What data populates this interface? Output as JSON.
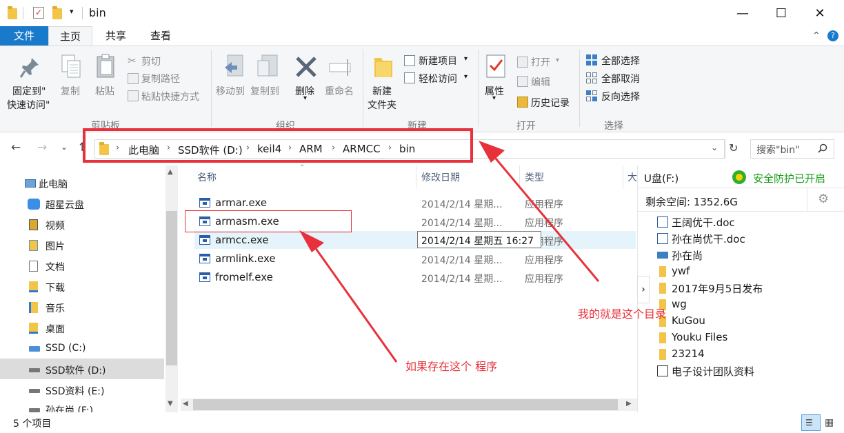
{
  "window": {
    "title": "bin",
    "minimize": "—",
    "maximize": "☐",
    "close": "✕"
  },
  "tabs": [
    "文件",
    "主页",
    "共享",
    "查看"
  ],
  "ribbon": {
    "pin_label_1": "固定到\"",
    "pin_label_2": "快速访问\"",
    "copy": "复制",
    "paste": "粘贴",
    "cut": "剪切",
    "copy_path": "复制路径",
    "paste_shortcut": "粘贴快捷方式",
    "clipboard_group": "剪贴板",
    "move_to": "移动到",
    "copy_to": "复制到",
    "delete": "删除",
    "rename": "重命名",
    "organize_group": "组织",
    "new_folder_1": "新建",
    "new_folder_2": "文件夹",
    "new_item": "新建项目",
    "easy_access": "轻松访问",
    "new_group": "新建",
    "properties": "属性",
    "open": "打开",
    "edit": "编辑",
    "history": "历史记录",
    "open_group": "打开",
    "select_all": "全部选择",
    "select_none": "全部取消",
    "invert_selection": "反向选择",
    "select_group": "选择"
  },
  "address": {
    "crumbs": [
      "此电脑",
      "SSD软件 (D:)",
      "keil4",
      "ARM",
      "ARMCC",
      "bin"
    ],
    "search_placeholder": "搜索\"bin\""
  },
  "nav": [
    {
      "label": "此电脑",
      "icon": "computer-icon"
    },
    {
      "label": "超星云盘",
      "icon": "cloud-drive-icon"
    },
    {
      "label": "视频",
      "icon": "video-icon"
    },
    {
      "label": "图片",
      "icon": "picture-icon"
    },
    {
      "label": "文档",
      "icon": "document-icon"
    },
    {
      "label": "下载",
      "icon": "download-icon"
    },
    {
      "label": "音乐",
      "icon": "music-icon"
    },
    {
      "label": "桌面",
      "icon": "desktop-icon"
    },
    {
      "label": "SSD (C:)",
      "icon": "drive-icon"
    },
    {
      "label": "SSD软件 (D:)",
      "icon": "drive-icon"
    },
    {
      "label": "SSD资料 (E:)",
      "icon": "drive-icon"
    },
    {
      "label": "孙在尚 (F:)",
      "icon": "drive-icon"
    }
  ],
  "columns": {
    "name": "名称",
    "date": "修改日期",
    "type": "类型",
    "size": "大"
  },
  "files": [
    {
      "name": "armar.exe",
      "date": "2014/2/14 星期...",
      "type": "应用程序"
    },
    {
      "name": "armasm.exe",
      "date": "2014/2/14 星期...",
      "type": "应用程序"
    },
    {
      "name": "armcc.exe",
      "date": "2014/2/14 星期...",
      "type": "应用程序"
    },
    {
      "name": "armlink.exe",
      "date": "2014/2/14 星期...",
      "type": "应用程序"
    },
    {
      "name": "fromelf.exe",
      "date": "2014/2/14 星期...",
      "type": "应用程序"
    }
  ],
  "tooltip": "2014/2/14 星期五 16:27",
  "usb_panel": {
    "title": "U盘(F:)",
    "protection": "安全防护已开启",
    "free_space": "剩余空间: 1352.6G",
    "items": [
      {
        "label": "王阔优干.doc",
        "icon": "word-doc-icon"
      },
      {
        "label": "孙在尚优干.doc",
        "icon": "word-doc-icon"
      },
      {
        "label": "孙在尚",
        "icon": "user-folder-icon"
      },
      {
        "label": "ywf",
        "icon": "folder-icon"
      },
      {
        "label": "2017年9月5日发布",
        "icon": "folder-icon"
      },
      {
        "label": "wg",
        "icon": "folder-icon"
      },
      {
        "label": "KuGou",
        "icon": "folder-icon"
      },
      {
        "label": "Youku Files",
        "icon": "folder-icon"
      },
      {
        "label": "23214",
        "icon": "folder-icon"
      },
      {
        "label": "电子设计团队资料",
        "icon": "file-icon"
      }
    ]
  },
  "status": {
    "count": "5 个项目"
  },
  "annotations": {
    "dir_note": "我的就是这个目录",
    "prog_note": "如果存在这个 程序"
  },
  "colors": {
    "accent": "#1979ca",
    "annotation": "#e8313a",
    "green": "#1aa01a"
  }
}
